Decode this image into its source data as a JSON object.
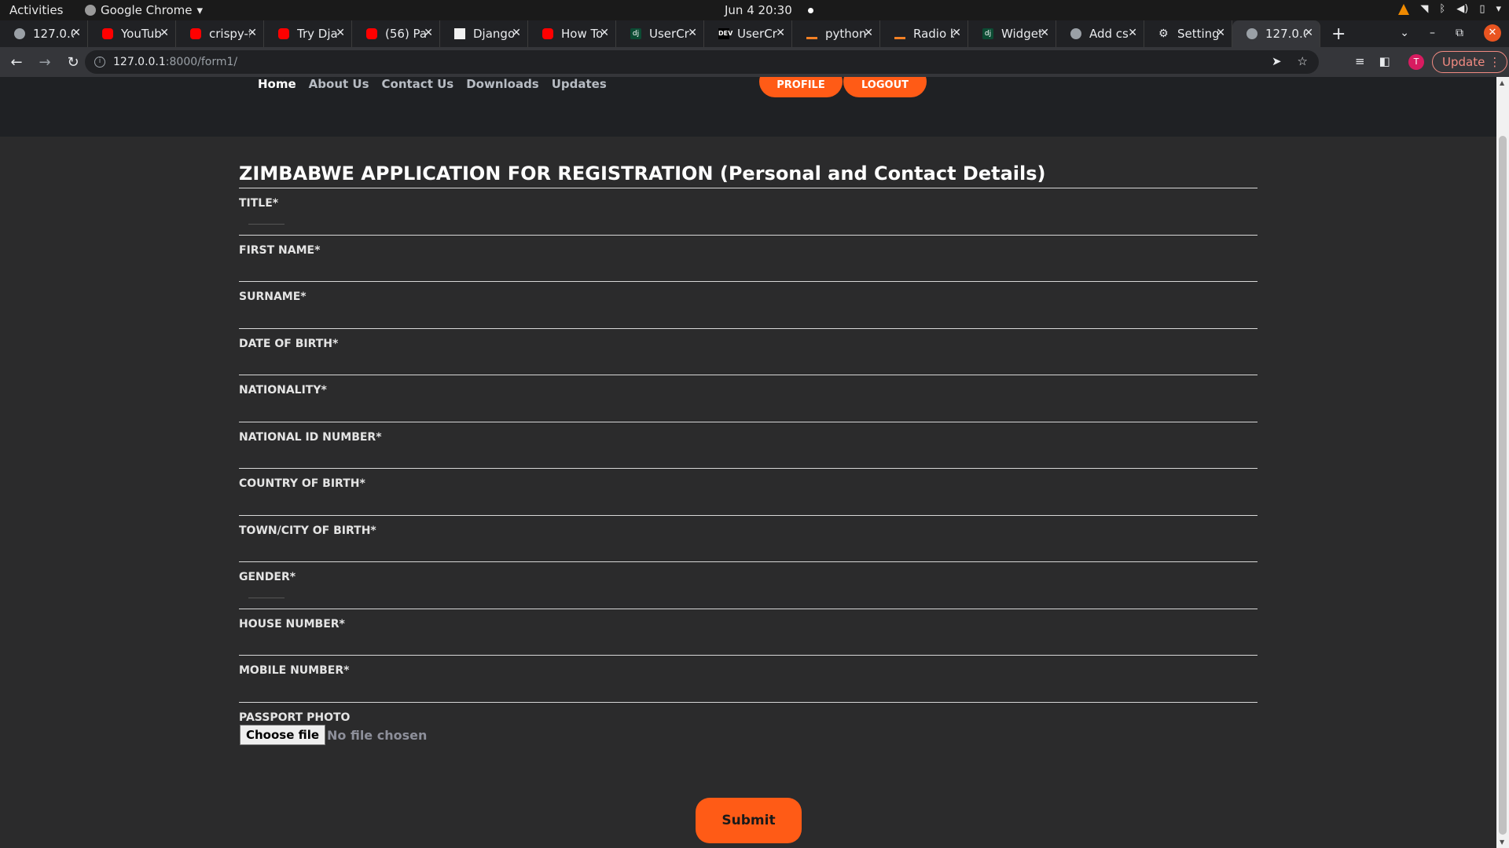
{
  "system": {
    "activities": "Activities",
    "app_name": "Google Chrome",
    "clock": "Jun 4  20:30"
  },
  "tabs": [
    {
      "title": "127.0.0",
      "favicon": "globe"
    },
    {
      "title": "YouTube",
      "favicon": "youtube"
    },
    {
      "title": "crispy-f",
      "favicon": "youtube"
    },
    {
      "title": "Try Dja",
      "favicon": "youtube"
    },
    {
      "title": "(56) Pa",
      "favicon": "youtube"
    },
    {
      "title": "Django",
      "favicon": "doc"
    },
    {
      "title": "How To",
      "favicon": "youtube"
    },
    {
      "title": "UserCr",
      "favicon": "django"
    },
    {
      "title": "UserCr",
      "favicon": "dev"
    },
    {
      "title": "python",
      "favicon": "stackoverflow"
    },
    {
      "title": "Radio b",
      "favicon": "stackoverflow"
    },
    {
      "title": "Widget",
      "favicon": "django"
    },
    {
      "title": "Add cs",
      "favicon": "globe"
    },
    {
      "title": "Setting",
      "favicon": "gear"
    },
    {
      "title": "127.0.0",
      "favicon": "globe",
      "active": true
    }
  ],
  "toolbar": {
    "url_host": "127.0.0.1",
    "url_path": ":8000/form1/",
    "profile_initial": "T",
    "update_label": "Update"
  },
  "site_nav": {
    "links": [
      "Home",
      "About Us",
      "Contact Us",
      "Downloads",
      "Updates"
    ],
    "profile_button": "PROFILE",
    "logout_button": "LOGOUT"
  },
  "form": {
    "title": "ZIMBABWE APPLICATION FOR REGISTRATION (Personal and Contact Details)",
    "fields": [
      "TITLE*",
      "FIRST NAME*",
      "SURNAME*",
      "DATE OF BIRTH*",
      "NATIONALITY*",
      "NATIONAL ID NUMBER*",
      "COUNTRY OF BIRTH*",
      "TOWN/CITY OF BIRTH*",
      "GENDER*",
      "HOUSE NUMBER*",
      "MOBILE NUMBER*"
    ],
    "photo_label": "PASSPORT PHOTO",
    "choose_file": "Choose file",
    "no_file": "No file chosen",
    "submit": "Submit"
  },
  "colors": {
    "accent": "#ff5b16",
    "page_bg": "#2b2b2c",
    "nav_bg": "#1f2124"
  }
}
